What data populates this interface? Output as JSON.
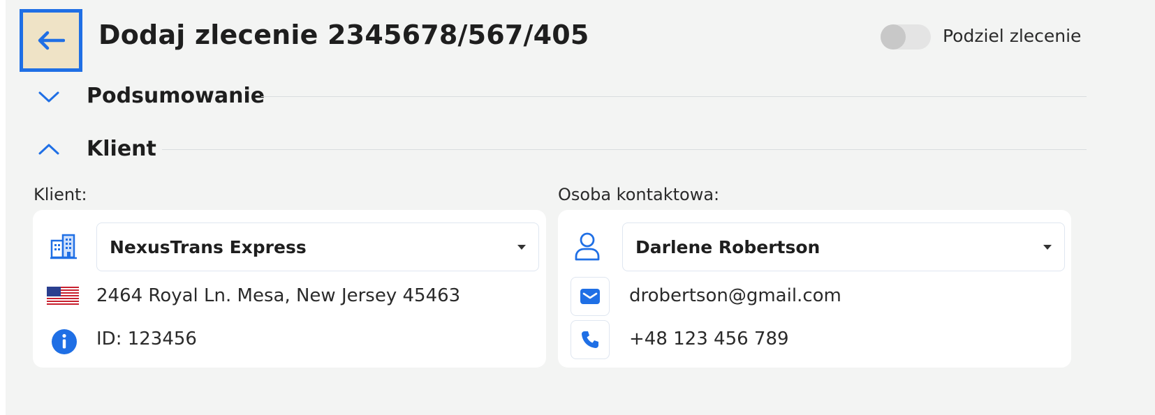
{
  "header": {
    "title": "Dodaj zlecenie 2345678/567/405",
    "split_toggle": {
      "label": "Podziel zlecenie",
      "on": false
    }
  },
  "sections": {
    "summary": {
      "title": "Podsumowanie",
      "expanded": false
    },
    "client": {
      "title": "Klient",
      "expanded": true
    }
  },
  "client": {
    "label": "Klient:",
    "selected": "NexusTrans Express",
    "address": "2464 Royal Ln. Mesa, New Jersey 45463",
    "id_text": "ID: 123456",
    "country_flag": "us-flag-icon"
  },
  "contact": {
    "label": "Osoba kontaktowa:",
    "selected": "Darlene Robertson",
    "email": "drobertson@gmail.com",
    "phone": "+48 123 456 789"
  },
  "colors": {
    "accent": "#1f6fe5",
    "background": "#f3f4f3",
    "back_button_bg": "#efe3c6"
  }
}
